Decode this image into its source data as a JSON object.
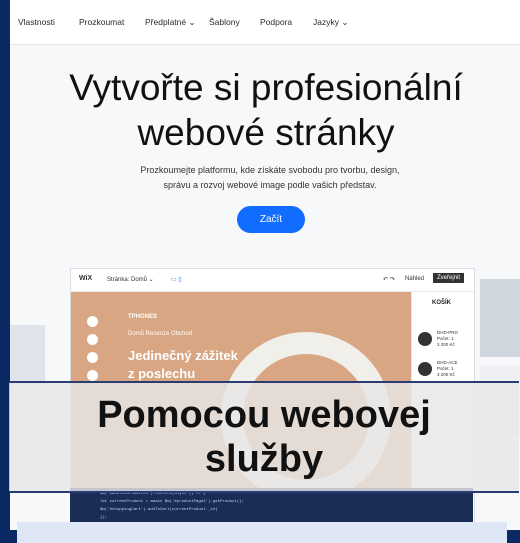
{
  "nav": {
    "items": [
      "Vlastnosti",
      "Prozkoumat",
      "Předplatné ⌄",
      "Šablony",
      "Podpora",
      "Jazyky ⌄"
    ]
  },
  "hero": {
    "title_line1": "Vytvořte si profesionální",
    "title_line2": "webové stránky",
    "subtitle_line1": "Prozkoumejte platformu, kde získáte svobodu pro tvorbu, design,",
    "subtitle_line2": "správu a rozvoj webové image podle vašich představ.",
    "cta": "Začít"
  },
  "editor": {
    "logo": "WiX",
    "page_select": "Stránka: Domů ⌄",
    "preview": "Náhled",
    "publish": "Zveřejnit",
    "brand": "TPHONES",
    "links": "Domů   Recenze   Obchod",
    "headline_line1": "Jedinečný zážitek",
    "headline_line2": "z poslechu",
    "cart_title": "KOŠÍK",
    "cart_items": [
      {
        "name": "DHD-PRO",
        "line2": "Počet: 1",
        "price": "3 200 Kč"
      },
      {
        "name": "DHD-ACE",
        "line2": "Počet: 1",
        "price": "3 200 Kč"
      }
    ]
  },
  "code_lines": [
    "$w('#addToCartButton').onClick(async () => {",
    "   let currentProduct = await $w('#productPage1').getProduct();",
    "   $w('#shoppingCart').addToCart(currentProduct._id)",
    "});"
  ],
  "overlay": {
    "text": "Pomocou webovej\nslužby"
  },
  "colors": {
    "frame": "#0b2a63",
    "accent": "#116dff",
    "canvas": "#d9a684"
  }
}
